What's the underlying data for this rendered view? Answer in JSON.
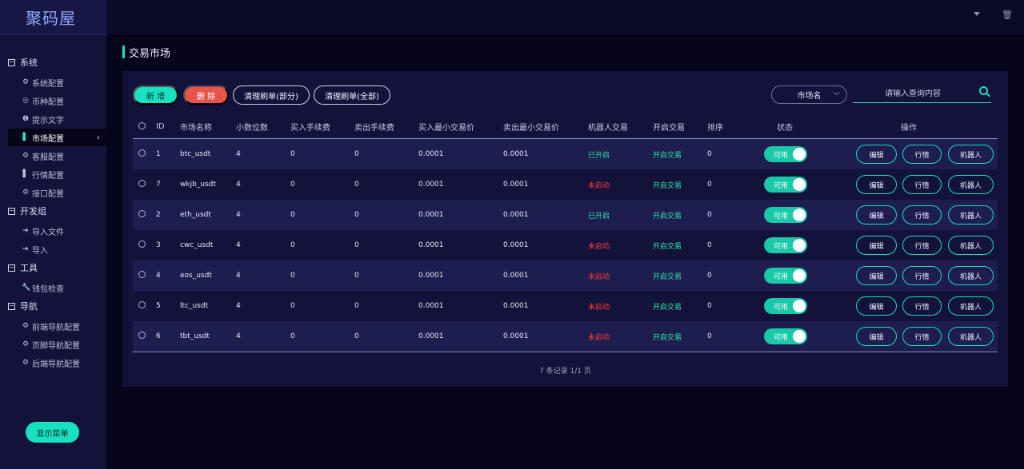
{
  "app": {
    "logo": "聚码屋"
  },
  "sidebar": {
    "groups": [
      {
        "title": "系统",
        "items": [
          {
            "label": "系统配置",
            "icon": "gear-icon"
          },
          {
            "label": "币种配置",
            "icon": "target-icon"
          },
          {
            "label": "提示文字",
            "icon": "info-icon"
          },
          {
            "label": "市场配置",
            "icon": "bar-chart-icon",
            "active": true
          },
          {
            "label": "客服配置",
            "icon": "gear-icon"
          },
          {
            "label": "行情配置",
            "icon": "bar-chart-icon"
          },
          {
            "label": "接口配置",
            "icon": "gear-icon"
          }
        ]
      },
      {
        "title": "开发组",
        "items": [
          {
            "label": "导入文件",
            "icon": "sign-in-icon"
          },
          {
            "label": "导入",
            "icon": "sign-in-icon"
          }
        ]
      },
      {
        "title": "工具",
        "items": [
          {
            "label": "钱包检查",
            "icon": "wrench-icon"
          }
        ]
      },
      {
        "title": "导航",
        "items": [
          {
            "label": "前端导航配置",
            "icon": "gear-icon"
          },
          {
            "label": "页脚导航配置",
            "icon": "gear-icon"
          },
          {
            "label": "后端导航配置",
            "icon": "gear-icon"
          }
        ]
      }
    ],
    "show_menu_label": "显示菜单"
  },
  "page": {
    "title": "交易市场"
  },
  "toolbar": {
    "add_label": "新 增",
    "delete_label": "删 除",
    "clear_partial_label": "清理刷单(部分)",
    "clear_all_label": "清理刷单(全部)",
    "market_select_label": "市场名",
    "search_placeholder": "请输入查询内容"
  },
  "table": {
    "headers": {
      "id": "ID",
      "name": "市场名称",
      "decimals": "小数位数",
      "buy_fee": "买入手续费",
      "sell_fee": "卖出手续费",
      "buy_min": "买入最小交易价",
      "sell_min": "卖出最小交易价",
      "robot": "机器人交易",
      "open_trade": "开启交易",
      "sort": "排序",
      "status": "状态",
      "ops": "操作"
    },
    "rows": [
      {
        "id": "1",
        "name": "btc_usdt",
        "decimals": "4",
        "buy_fee": "0",
        "sell_fee": "0",
        "buy_min": "0.0001",
        "sell_min": "0.0001",
        "robot": "已开启",
        "robot_on": true,
        "open_trade": "开启交易",
        "sort": "0",
        "status": "可用"
      },
      {
        "id": "7",
        "name": "wkjb_usdt",
        "decimals": "4",
        "buy_fee": "0",
        "sell_fee": "0",
        "buy_min": "0.0001",
        "sell_min": "0.0001",
        "robot": "未启动",
        "robot_on": false,
        "open_trade": "开启交易",
        "sort": "0",
        "status": "可用"
      },
      {
        "id": "2",
        "name": "eth_usdt",
        "decimals": "4",
        "buy_fee": "0",
        "sell_fee": "0",
        "buy_min": "0.0001",
        "sell_min": "0.0001",
        "robot": "已开启",
        "robot_on": true,
        "open_trade": "开启交易",
        "sort": "0",
        "status": "可用"
      },
      {
        "id": "3",
        "name": "cwc_usdt",
        "decimals": "4",
        "buy_fee": "0",
        "sell_fee": "0",
        "buy_min": "0.0001",
        "sell_min": "0.0001",
        "robot": "未启动",
        "robot_on": false,
        "open_trade": "开启交易",
        "sort": "0",
        "status": "可用"
      },
      {
        "id": "4",
        "name": "eos_usdt",
        "decimals": "4",
        "buy_fee": "0",
        "sell_fee": "0",
        "buy_min": "0.0001",
        "sell_min": "0.0001",
        "robot": "未启动",
        "robot_on": false,
        "open_trade": "开启交易",
        "sort": "0",
        "status": "可用"
      },
      {
        "id": "5",
        "name": "ltc_usdt",
        "decimals": "4",
        "buy_fee": "0",
        "sell_fee": "0",
        "buy_min": "0.0001",
        "sell_min": "0.0001",
        "robot": "未启动",
        "robot_on": false,
        "open_trade": "开启交易",
        "sort": "0",
        "status": "可用"
      },
      {
        "id": "6",
        "name": "tbt_usdt",
        "decimals": "4",
        "buy_fee": "0",
        "sell_fee": "0",
        "buy_min": "0.0001",
        "sell_min": "0.0001",
        "robot": "未启动",
        "robot_on": false,
        "open_trade": "开启交易",
        "sort": "0",
        "status": "可用"
      }
    ],
    "op_labels": {
      "edit": "编辑",
      "quote": "行情",
      "robot": "机器人"
    }
  },
  "pagination": {
    "summary": "7 条记录 1/1 页"
  },
  "colors": {
    "accent": "#19e0c0",
    "danger": "#e8544a",
    "robot_on": "#2ee6a8",
    "robot_off": "#ff3a3a"
  }
}
